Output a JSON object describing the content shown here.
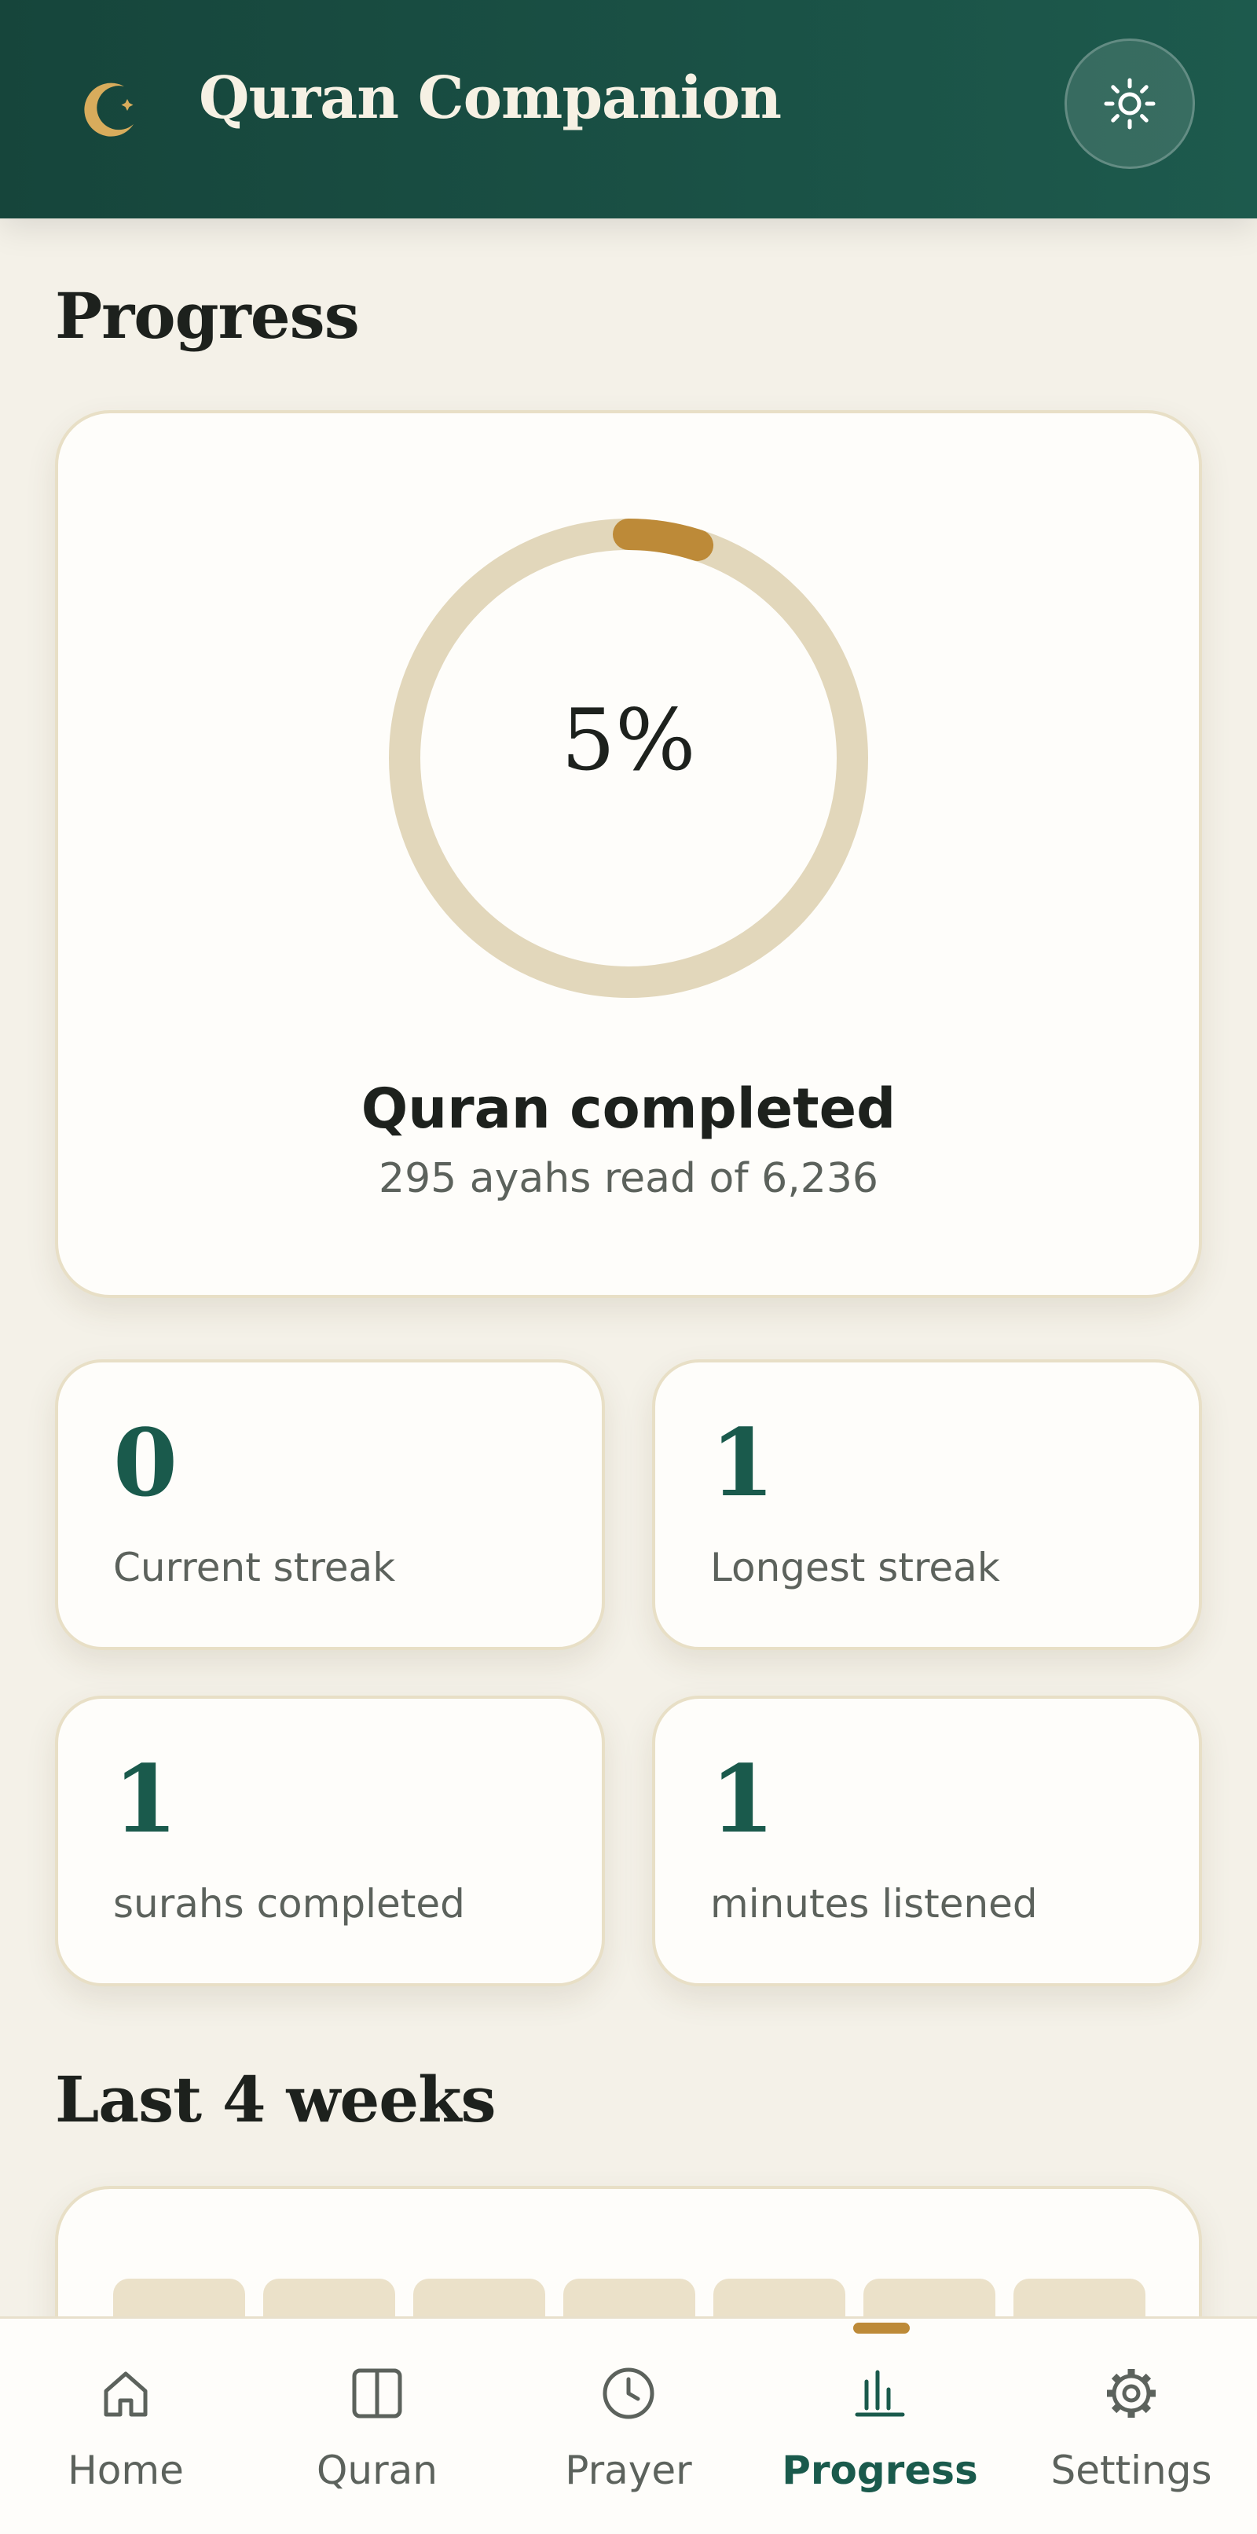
{
  "app": {
    "title": "Quran Companion",
    "icons": {
      "logo": "crescent-moon-icon",
      "theme_toggle": "sun-icon"
    }
  },
  "colors": {
    "header": "#1d5a4d",
    "accent": "#bd8a38",
    "ring_track": "#e2d7bb",
    "stat_value": "#1a5a4c",
    "background": "#f4f1e8"
  },
  "progress": {
    "section_title": "Progress",
    "percent_value": 5,
    "percent_text": "5%",
    "completed_label": "Quran completed",
    "completed_sub": "295 ayahs read of 6,236",
    "ayahs_read": 295,
    "ayahs_total": 6236
  },
  "stats": [
    {
      "value": "0",
      "label": "Current streak"
    },
    {
      "value": "1",
      "label": "Longest streak"
    },
    {
      "value": "1",
      "label": "surahs completed"
    },
    {
      "value": "1",
      "label": "minutes listened"
    }
  ],
  "weeks": {
    "section_title": "Last 4 weeks",
    "bars_visible": 7
  },
  "nav": {
    "active": "Progress",
    "items": [
      {
        "label": "Home",
        "icon": "home-icon"
      },
      {
        "label": "Quran",
        "icon": "book-icon"
      },
      {
        "label": "Prayer",
        "icon": "clock-icon"
      },
      {
        "label": "Progress",
        "icon": "bar-chart-icon"
      },
      {
        "label": "Settings",
        "icon": "gear-icon"
      }
    ]
  }
}
